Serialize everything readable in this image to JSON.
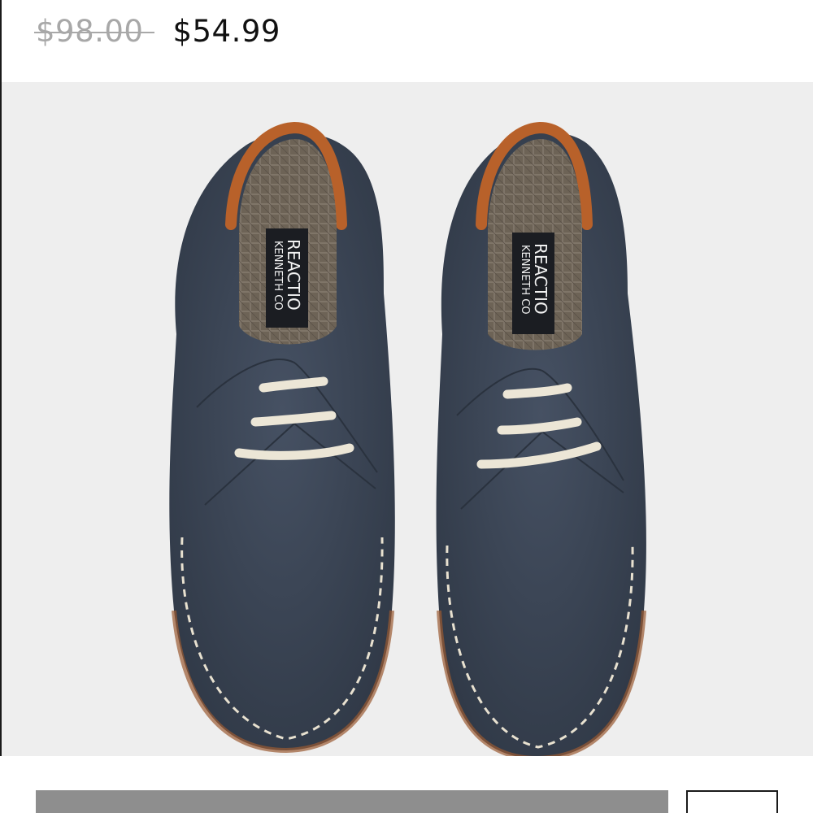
{
  "listing": {
    "original_price": "$98.00",
    "sale_price": "$54.99"
  },
  "product_image": {
    "subject": "navy suede chukka shoes, top view",
    "brand_label_line1": "KENNETH CO",
    "brand_label_line2": "REACTIO"
  },
  "colors": {
    "suede": "#3c4656",
    "leather_trim": "#b8612a",
    "laces": "#ece6d6",
    "button_gray": "#8e8e8e"
  }
}
